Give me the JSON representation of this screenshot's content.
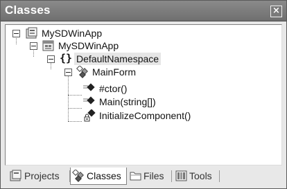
{
  "window": {
    "title": "Classes",
    "close_glyph": "×"
  },
  "tree": [
    {
      "label": "MySDWinApp",
      "icon": "solution-icon"
    },
    {
      "label": "MySDWinApp",
      "icon": "project-icon"
    },
    {
      "label": "DefaultNamespace",
      "icon": "namespace-icon",
      "selected": true
    },
    {
      "label": "MainForm",
      "icon": "class-icon"
    },
    {
      "label": "#ctor()",
      "icon": "method-icon"
    },
    {
      "label": "Main(string[])",
      "icon": "method-icon"
    },
    {
      "label": "InitializeComponent()",
      "icon": "private-method-icon"
    }
  ],
  "tabs": [
    {
      "label": "Projects",
      "icon": "projects-icon"
    },
    {
      "label": "Classes",
      "icon": "classes-icon",
      "active": true
    },
    {
      "label": "Files",
      "icon": "folder-icon"
    },
    {
      "label": "Tools",
      "icon": "tools-icon"
    }
  ]
}
